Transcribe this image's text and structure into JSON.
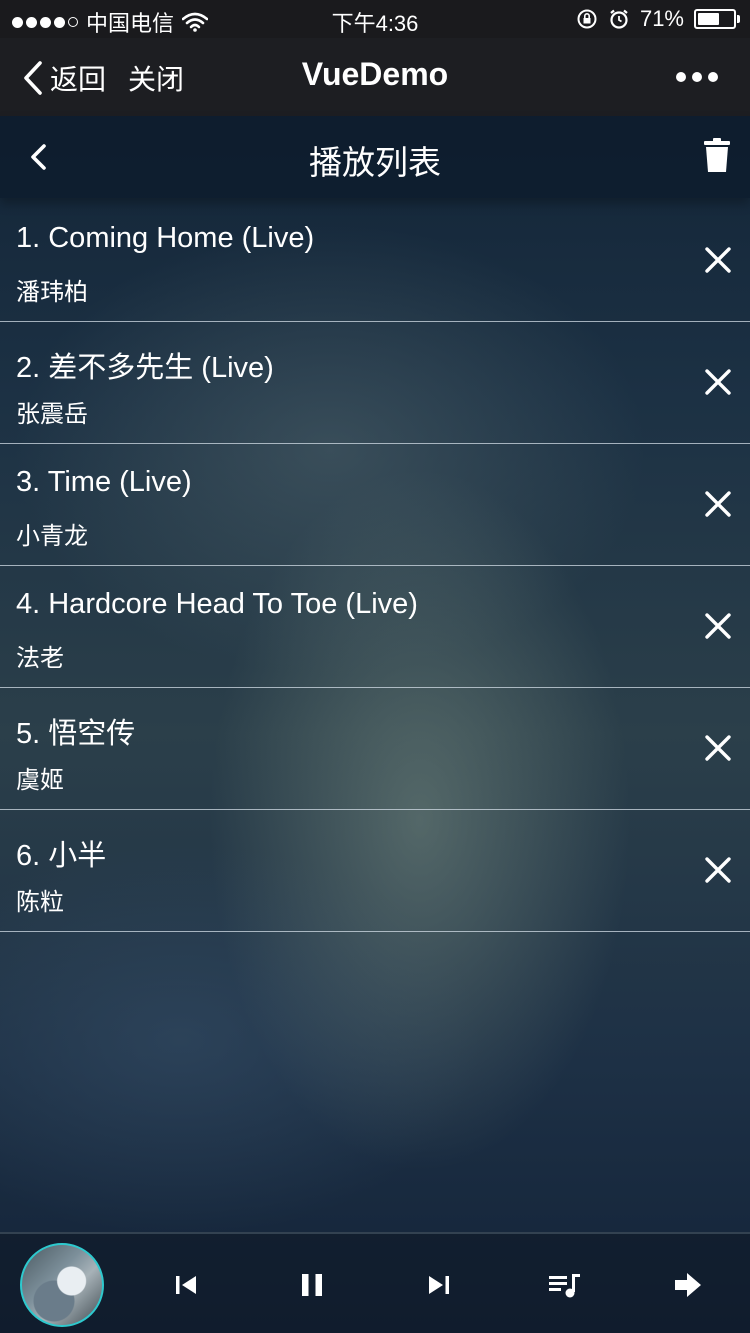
{
  "status_bar": {
    "carrier": "中国电信",
    "time": "下午4:36",
    "battery": "71%",
    "battery_level": 0.71
  },
  "wx_nav": {
    "back_label": "返回",
    "close_label": "关闭",
    "title": "VueDemo"
  },
  "page": {
    "title": "播放列表"
  },
  "playlist": [
    {
      "title": "1. Coming Home (Live)",
      "artist": "潘玮柏"
    },
    {
      "title": "2. 差不多先生 (Live)",
      "artist": "张震岳"
    },
    {
      "title": "3. Time (Live)",
      "artist": "小青龙"
    },
    {
      "title": "4. Hardcore Head To Toe (Live)",
      "artist": "法老"
    },
    {
      "title": "5. 悟空传",
      "artist": "虞姬"
    },
    {
      "title": "6. 小半",
      "artist": "陈粒"
    }
  ],
  "player": {
    "icons": [
      "prev-icon",
      "pause-icon",
      "next-icon",
      "playlist-icon",
      "forward-arrow-icon"
    ],
    "accent": "#2ec9ce"
  }
}
